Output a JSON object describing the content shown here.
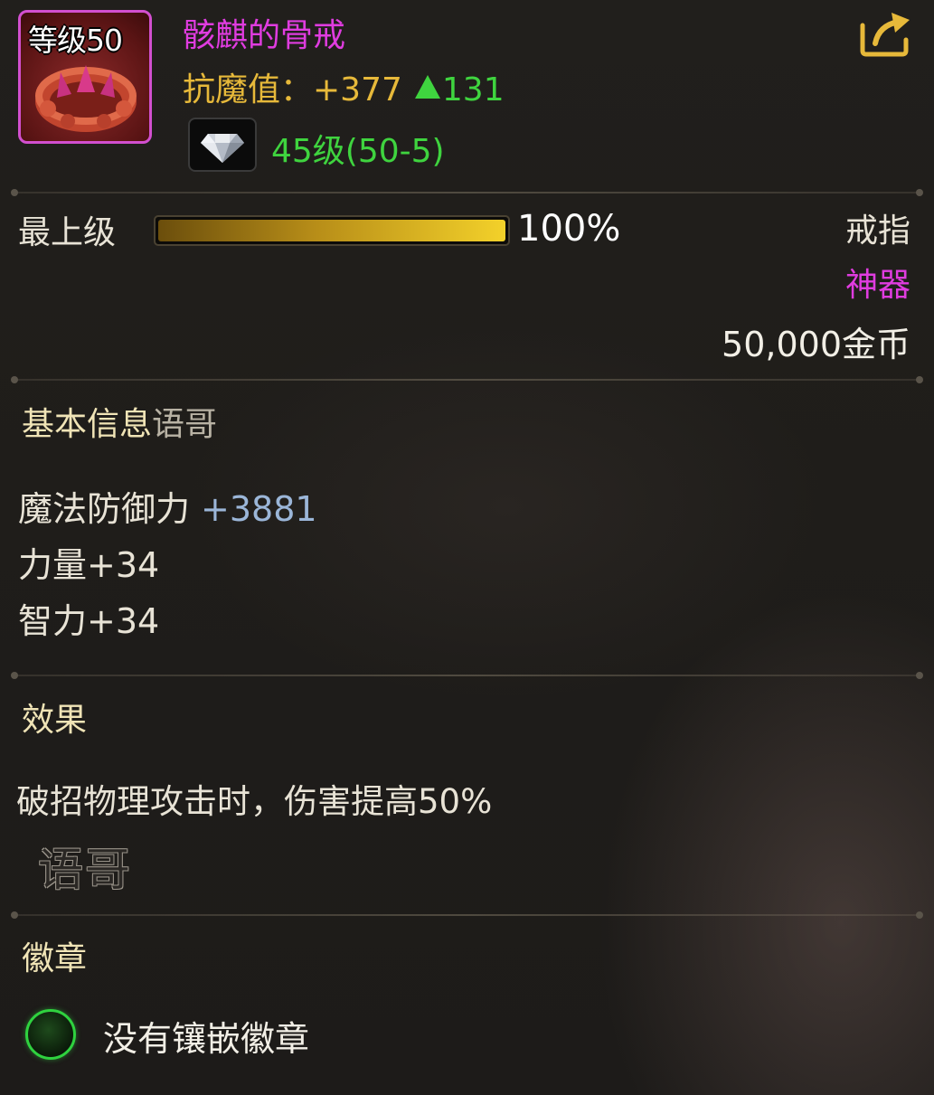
{
  "item": {
    "level_badge": "等级50",
    "name": "骸麒的骨戒",
    "stat_label": "抗魔值：+377",
    "stat_increase": "131",
    "gem_level": "45级(50-5)",
    "type": "戒指",
    "quality": "神器",
    "price": "50,000金币"
  },
  "refine": {
    "label": "最上级",
    "progress_percent": 100,
    "progress_text": "100%"
  },
  "basic_info": {
    "title": "基本信息",
    "title_suffix": "语哥",
    "attributes": [
      {
        "name": "魔法防御力",
        "value": "+3881"
      },
      {
        "text": "力量+34"
      },
      {
        "text": "智力+34"
      }
    ]
  },
  "effect": {
    "title": "效果",
    "text": "破招物理攻击时，伤害提高50%",
    "watermark": "语哥"
  },
  "badge": {
    "title": "徽章",
    "status": "没有镶嵌徽章"
  },
  "colors": {
    "name_purple": "#e03ce0",
    "stat_gold": "#e7b93a",
    "increase_green": "#3fd43f",
    "defense_blue": "#9bb6d8",
    "badge_ring_green": "#2fd23f"
  },
  "icons": {
    "share": "share-export-icon",
    "gem": "diamond-gem-icon",
    "item": "bone-ring-icon"
  }
}
